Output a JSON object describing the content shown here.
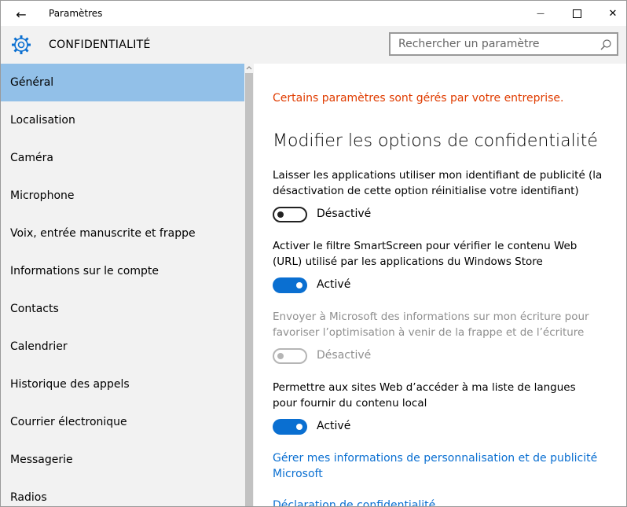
{
  "window": {
    "title": "Paramètres",
    "back_glyph": "←",
    "minimize_glyph": "—",
    "close_glyph": "✕"
  },
  "header": {
    "title": "CONFIDENTIALITÉ",
    "icon": "gear-icon",
    "accent_color": "#0a6fd1"
  },
  "search": {
    "placeholder": "Rechercher un paramètre",
    "value": ""
  },
  "sidebar": {
    "selected_color": "#92c0e8",
    "items": [
      {
        "label": "Général",
        "selected": true
      },
      {
        "label": "Localisation"
      },
      {
        "label": "Caméra"
      },
      {
        "label": "Microphone"
      },
      {
        "label": "Voix, entrée manuscrite et frappe"
      },
      {
        "label": "Informations sur le compte"
      },
      {
        "label": "Contacts"
      },
      {
        "label": "Calendrier"
      },
      {
        "label": "Historique des appels"
      },
      {
        "label": "Courrier électronique"
      },
      {
        "label": "Messagerie"
      },
      {
        "label": "Radios"
      }
    ]
  },
  "main": {
    "warning": "Certains paramètres sont gérés par votre entreprise.",
    "warning_color": "#e03c00",
    "heading": "Modifier les options de confidentialité",
    "options": [
      {
        "text": "Laisser les applications utiliser mon identifiant de publicité (la désactivation de cette option réinitialise votre identifiant)",
        "state": "Désactivé",
        "on": false,
        "enabled": true
      },
      {
        "text": "Activer le filtre SmartScreen pour vérifier le contenu Web (URL) utilisé par les applications du Windows Store",
        "state": "Activé",
        "on": true,
        "enabled": true
      },
      {
        "text": "Envoyer à Microsoft des informations sur mon écriture pour favoriser l’optimisation à venir de la frappe et de l’écriture",
        "state": "Désactivé",
        "on": false,
        "enabled": false
      },
      {
        "text": "Permettre aux sites Web d’accéder à ma liste de langues pour fournir du contenu local",
        "state": "Activé",
        "on": true,
        "enabled": true
      }
    ],
    "links": [
      "Gérer mes informations de personnalisation et de publicité Microsoft",
      "Déclaration de confidentialité"
    ]
  }
}
